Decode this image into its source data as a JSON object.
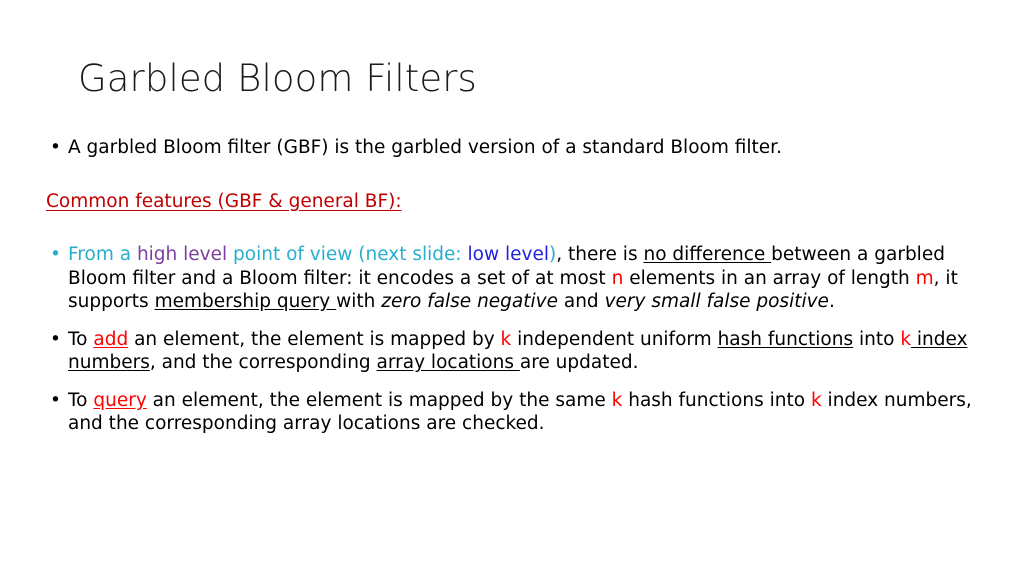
{
  "slide": {
    "title": "Garbled Bloom Filters",
    "bullet_char": "•",
    "colors": {
      "title": "#1a1a1a",
      "text": "#000000",
      "accent_red": "#FF0000",
      "dark_red": "#C00000",
      "cyan": "#27AECE",
      "purple": "#7D3F9E",
      "blue": "#2222DD",
      "background": "#FFFFFF"
    },
    "intro_bullet": {
      "text": "A garbled Bloom filter (GBF) is the garbled version of a standard Bloom filter."
    },
    "section_heading": {
      "text": "Common features (GBF & general BF):"
    },
    "bullet_view": {
      "seg_from_a": "From a ",
      "seg_high_level": "high level",
      "seg_point_of_view": " point of view (next slide: ",
      "seg_low_level": "low level",
      "seg_close_paren": ")",
      "seg_there_is": ", there is ",
      "seg_no_difference": "no difference ",
      "seg_between": "between a garbled Bloom filter and a Bloom filter: it encodes a set of at most ",
      "seg_n": "n",
      "seg_elements_array": " elements in an array of length ",
      "seg_m": "m",
      "seg_it_supports": ", it supports ",
      "seg_membership_query": "membership query ",
      "seg_with": "with ",
      "seg_zero_false_negative": "zero false negative",
      "seg_and": " and ",
      "seg_very_small_false_positive": "very small false positive",
      "seg_period": "."
    },
    "bullet_add": {
      "seg_to": "To ",
      "seg_add": "add",
      "seg_an_element": " an element, the element is mapped by ",
      "seg_k1": "k",
      "seg_independent": " independent uniform ",
      "seg_hash_functions": "hash functions",
      "seg_into": " into ",
      "seg_k2": "k",
      "seg_index_numbers": " index numbers",
      "seg_and_corresponding": ", and the corresponding ",
      "seg_array_locations": "array locations ",
      "seg_are_updated": "are updated."
    },
    "bullet_query": {
      "seg_to": "To ",
      "seg_query": "query",
      "seg_an_element": " an element, the element is mapped by the same ",
      "seg_k1": "k",
      "seg_hash_functions": " hash functions into ",
      "seg_k2": "k",
      "seg_index_numbers": " index numbers, and the corresponding array locations are checked."
    }
  }
}
